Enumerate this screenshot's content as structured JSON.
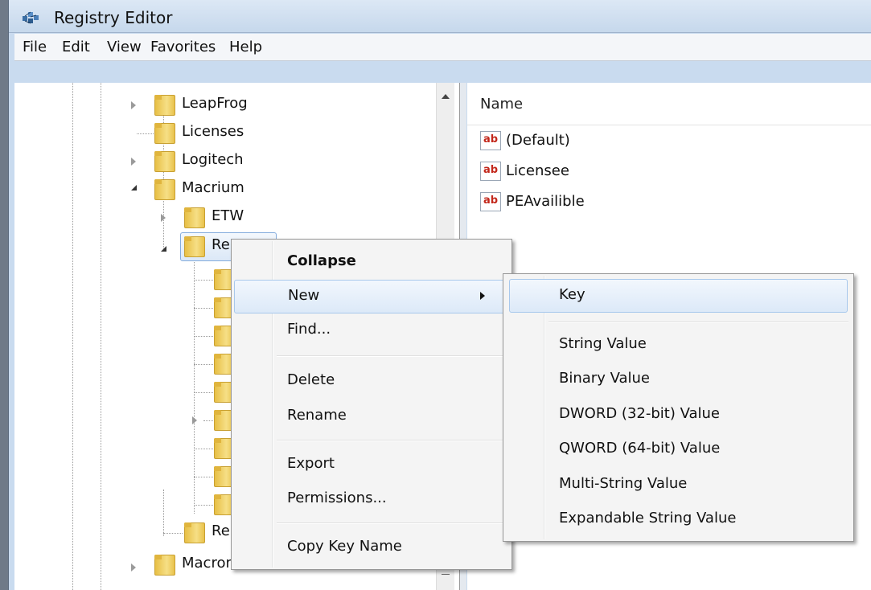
{
  "window": {
    "title": "Registry Editor"
  },
  "menubar": {
    "items": [
      "File",
      "Edit",
      "View",
      "Favorites",
      "Help"
    ]
  },
  "tree": {
    "items": [
      {
        "label": "LeapFrog"
      },
      {
        "label": "Licenses"
      },
      {
        "label": "Logitech"
      },
      {
        "label": "Macrium"
      },
      {
        "label": "ETW"
      },
      {
        "label": "Re"
      },
      {
        "label": "Re"
      },
      {
        "label": "Macromedia"
      }
    ]
  },
  "values": {
    "column_name": "Name",
    "rows": [
      {
        "name": "(Default)",
        "icon": "string-value-icon"
      },
      {
        "name": "Licensee",
        "icon": "string-value-icon"
      },
      {
        "name": "PEAvailible",
        "icon": "string-value-icon"
      }
    ]
  },
  "context_menu": {
    "items": [
      "Collapse",
      "New",
      "Find...",
      "Delete",
      "Rename",
      "Export",
      "Permissions...",
      "Copy Key Name"
    ]
  },
  "submenu": {
    "items": [
      "Key",
      "String Value",
      "Binary Value",
      "DWORD (32-bit) Value",
      "QWORD (64-bit) Value",
      "Multi-String Value",
      "Expandable String Value"
    ]
  },
  "colors": {
    "highlight_border": "#a8c8ec",
    "window_frame": "#c9dbef",
    "folder": "#f6df86"
  }
}
